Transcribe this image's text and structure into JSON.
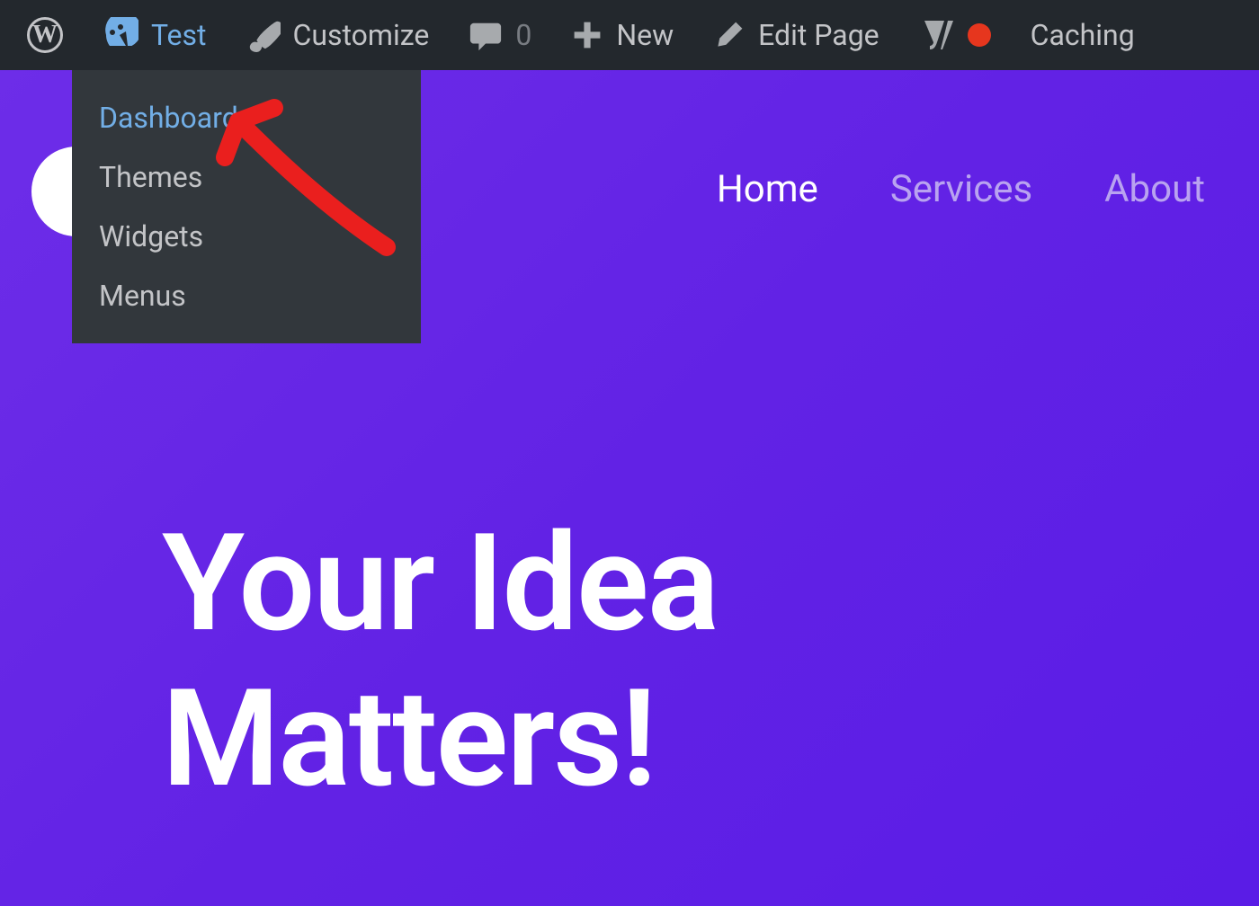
{
  "adminBar": {
    "siteName": "Test",
    "customize": "Customize",
    "commentsCount": "0",
    "new": "New",
    "editPage": "Edit Page",
    "caching": "Caching"
  },
  "dropdown": {
    "items": [
      {
        "label": "Dashboard",
        "highlighted": true
      },
      {
        "label": "Themes",
        "highlighted": false
      },
      {
        "label": "Widgets",
        "highlighted": false
      },
      {
        "label": "Menus",
        "highlighted": false
      }
    ]
  },
  "siteNav": {
    "items": [
      {
        "label": "Home",
        "active": true
      },
      {
        "label": "Services",
        "active": false
      },
      {
        "label": "About",
        "active": false
      }
    ]
  },
  "hero": {
    "line1": "Your Idea",
    "line2": "Matters!"
  }
}
